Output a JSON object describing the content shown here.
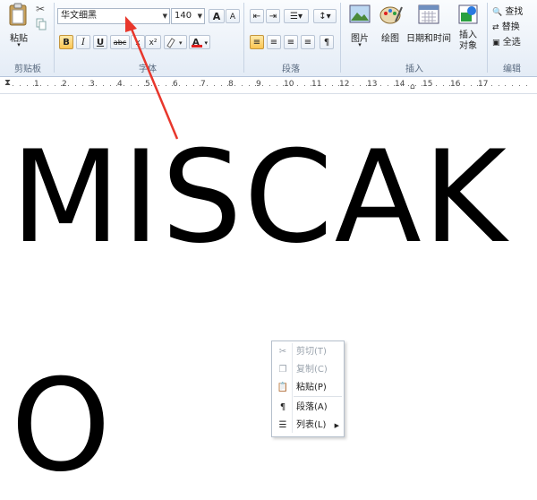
{
  "ribbon": {
    "clipboard": {
      "label": "剪贴板",
      "paste_label": "粘贴"
    },
    "font": {
      "label": "字体",
      "font_name": "华文细黑",
      "font_size": "140",
      "grow_label": "A",
      "shrink_label": "A",
      "bold": "B",
      "italic": "I",
      "underline": "U",
      "strike": "abc",
      "superscript": "x²",
      "font_color": "A"
    },
    "paragraph": {
      "label": "段落"
    },
    "insert": {
      "label": "插入",
      "picture": "图片",
      "paint": "绘图",
      "datetime": "日期和时间",
      "object_line1": "插入",
      "object_line2": "对象"
    },
    "edit": {
      "label": "编辑",
      "find": "查找",
      "replace": "替换",
      "select_all": "全选"
    }
  },
  "ruler": {
    "ticks": [
      "1",
      "2",
      "3",
      "4",
      "5",
      "6",
      "7",
      "8",
      "9",
      "10",
      "11",
      "12",
      "13",
      "14",
      "15",
      "16",
      "17"
    ]
  },
  "document": {
    "line1": "MISCAK",
    "line2": "O"
  },
  "context_menu": {
    "items": [
      {
        "label": "剪切(T)",
        "icon": "scissors-icon",
        "enabled": false
      },
      {
        "label": "复制(C)",
        "icon": "copy-icon",
        "enabled": false
      },
      {
        "label": "粘贴(P)",
        "icon": "paste-icon",
        "enabled": true
      },
      {
        "label": "段落(A)",
        "icon": "paragraph-icon",
        "enabled": true
      },
      {
        "label": "列表(L)",
        "icon": "list-icon",
        "enabled": true,
        "submenu": true
      }
    ]
  },
  "colors": {
    "annotation_arrow": "#e8372c",
    "highlight": "#fbc552",
    "font_color_bar": "#e02020"
  }
}
